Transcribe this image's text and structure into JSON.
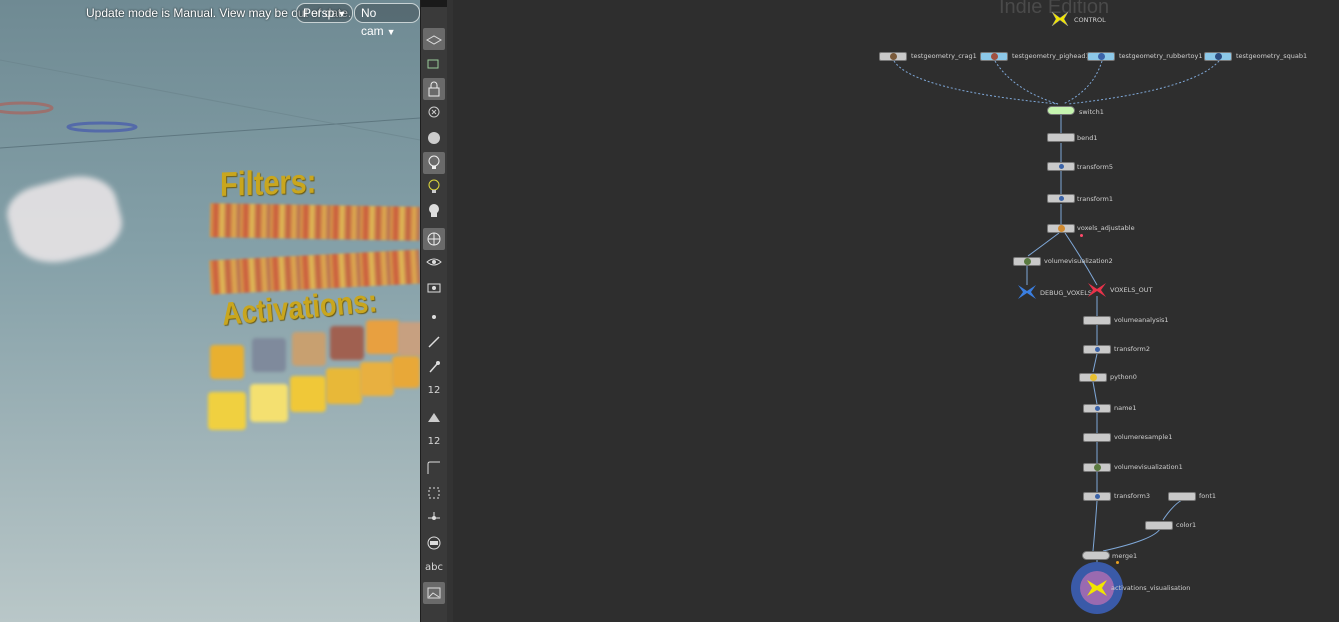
{
  "viewport": {
    "message": "Update mode is Manual. View may be out of date.",
    "persp_menu": "Persp",
    "cam_menu": "No cam",
    "filters_label": "Filters:",
    "activations_label": "Activations:"
  },
  "toolbar": {
    "abc_label": "abc",
    "num_label_1": "12",
    "num_label_2": "12"
  },
  "network": {
    "watermark": "Indie Edition",
    "nodes": {
      "control": "CONTROL",
      "crag": "testgeometry_crag1",
      "pighead": "testgeometry_pighead1",
      "rubbertoy": "testgeometry_rubbertoy1",
      "squab": "testgeometry_squab1",
      "switch1": "switch1",
      "bend1": "bend1",
      "transform5": "transform5",
      "transform1": "transform1",
      "voxels_adjustable": "voxels_adjustable",
      "volumevisualization2": "volumevisualization2",
      "debug_voxels": "DEBUG_VOXELS",
      "voxels_out": "VOXELS_OUT",
      "volumeanalysis1": "volumeanalysis1",
      "transform2": "transform2",
      "python0": "python0",
      "name1": "name1",
      "volumeresample1": "volumeresample1",
      "volumevisualization1": "volumevisualization1",
      "transform3": "transform3",
      "font1": "font1",
      "color1": "color1",
      "merge1": "merge1",
      "activations_visualisation": "activations_visualisation"
    }
  },
  "colors": {
    "accent_yellow": "#c9a61e",
    "null_yellow": "#f2e600",
    "null_red": "#e8324a",
    "null_blue": "#3a7ee0",
    "display_ring": "#3a5aa8"
  }
}
